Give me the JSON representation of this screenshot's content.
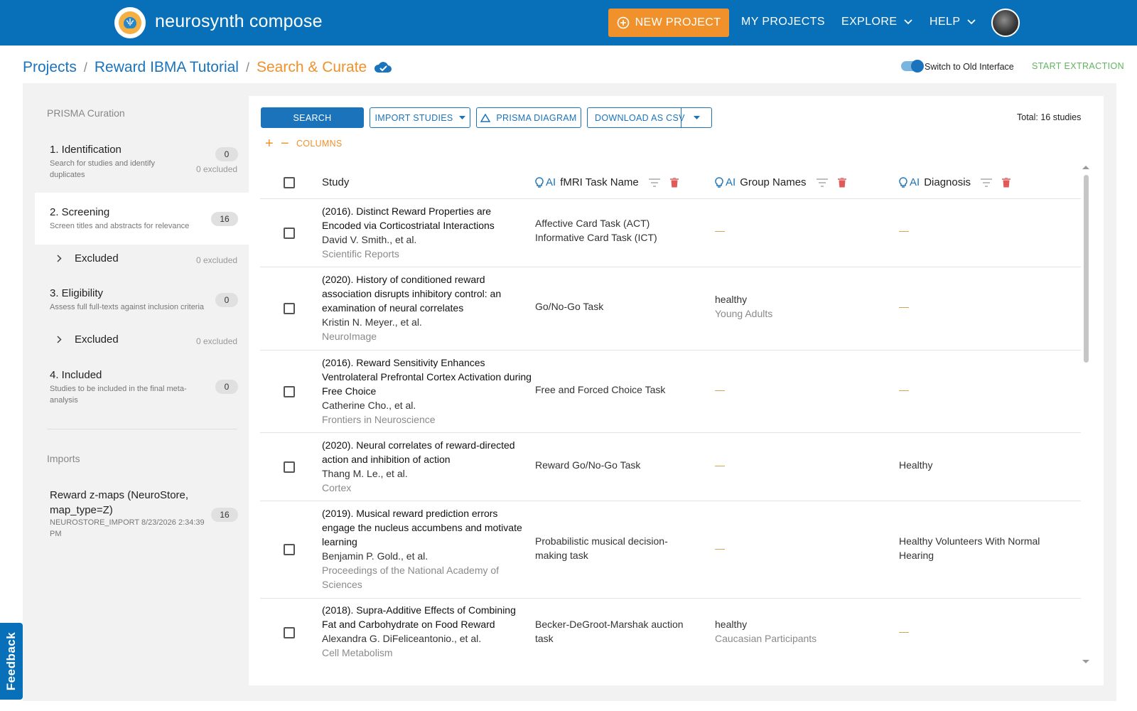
{
  "header": {
    "brand": "neurosynth compose",
    "new_project": "NEW PROJECT",
    "my_projects": "MY PROJECTS",
    "explore": "EXPLORE",
    "help": "HELP"
  },
  "breadcrumb": {
    "projects": "Projects",
    "project": "Reward IBMA Tutorial",
    "current": "Search & Curate"
  },
  "top_right": {
    "switch_label": "Switch to Old Interface",
    "start_extraction": "START EXTRACTION"
  },
  "sidebar": {
    "heading": "PRISMA Curation",
    "steps": [
      {
        "title": "1. Identification",
        "desc": "Search for studies and identify duplicates",
        "count": "0",
        "excluded": "0 excluded"
      },
      {
        "title": "2. Screening",
        "desc": "Screen titles and abstracts for relevance",
        "count": "16"
      },
      {
        "title": "3. Eligibility",
        "desc": "Assess full full-texts against inclusion criteria",
        "count": "0"
      },
      {
        "title": "4. Included",
        "desc": "Studies to be included in the final meta-analysis",
        "count": "0"
      }
    ],
    "sub_excluded": [
      {
        "label": "Excluded",
        "count": "0 excluded"
      },
      {
        "label": "Excluded",
        "count": "0 excluded"
      }
    ],
    "imports_heading": "Imports",
    "import": {
      "title": "Reward z-maps (NeuroStore, map_type=Z)",
      "meta": "NEUROSTORE_IMPORT 8/23/2026 2:34:39 PM",
      "count": "16"
    }
  },
  "toolbar": {
    "search": "SEARCH",
    "import_studies": "IMPORT STUDIES",
    "prisma_diagram": "PRISMA DIAGRAM",
    "download_csv": "DOWNLOAD AS CSV",
    "total": "Total: 16 studies",
    "columns": "COLUMNS"
  },
  "table": {
    "headers": {
      "study": "Study",
      "ai": "AI",
      "task": "fMRI Task Name",
      "groups": "Group Names",
      "diagnosis": "Diagnosis"
    },
    "rows": [
      {
        "title": "(2016). Distinct Reward Properties are Encoded via Corticostriatal Interactions",
        "authors": "David V. Smith., et al.",
        "journal": "Scientific Reports",
        "task": "Affective Card Task (ACT)",
        "task2": "Informative Card Task (ICT)",
        "group": "—",
        "group2": "",
        "diagnosis": "—"
      },
      {
        "title": "(2020). History of conditioned reward association disrupts inhibitory control: an examination of neural correlates",
        "authors": "Kristin N. Meyer., et al.",
        "journal": "NeuroImage",
        "task": "Go/No-Go Task",
        "task2": "",
        "group": "healthy",
        "group2": "Young Adults",
        "diagnosis": "—"
      },
      {
        "title": "(2016). Reward Sensitivity Enhances Ventrolateral Prefrontal Cortex Activation during Free Choice",
        "authors": "Catherine Cho., et al.",
        "journal": "Frontiers in Neuroscience",
        "task": "Free and Forced Choice Task",
        "task2": "",
        "group": "—",
        "group2": "",
        "diagnosis": "—"
      },
      {
        "title": "(2020). Neural correlates of reward-directed action and inhibition of action",
        "authors": "Thang M. Le., et al.",
        "journal": "Cortex",
        "task": "Reward Go/No-Go Task",
        "task2": "",
        "group": "—",
        "group2": "",
        "diagnosis": "Healthy"
      },
      {
        "title": "(2019). Musical reward prediction errors engage the nucleus accumbens and motivate learning",
        "authors": "Benjamin P. Gold., et al.",
        "journal": "Proceedings of the National Academy of Sciences",
        "task": "Probabilistic musical decision-making task",
        "task2": "",
        "group": "—",
        "group2": "",
        "diagnosis": "Healthy Volunteers With Normal Hearing"
      },
      {
        "title": "(2018). Supra-Additive Effects of Combining Fat and Carbohydrate on Food Reward",
        "authors": "Alexandra G. DiFeliceantonio., et al.",
        "journal": "Cell Metabolism",
        "task": "Becker-DeGroot-Marshak auction task",
        "task2": "",
        "group": "healthy",
        "group2": "Caucasian Participants",
        "diagnosis": "—"
      }
    ]
  },
  "feedback": "Feedback",
  "colors": {
    "header_bg": "#0770b8",
    "accent_orange": "#f0912b",
    "link_blue": "#1b74bb",
    "delete_red": "#e05a5a",
    "extraction_green": "#5fb55f"
  }
}
